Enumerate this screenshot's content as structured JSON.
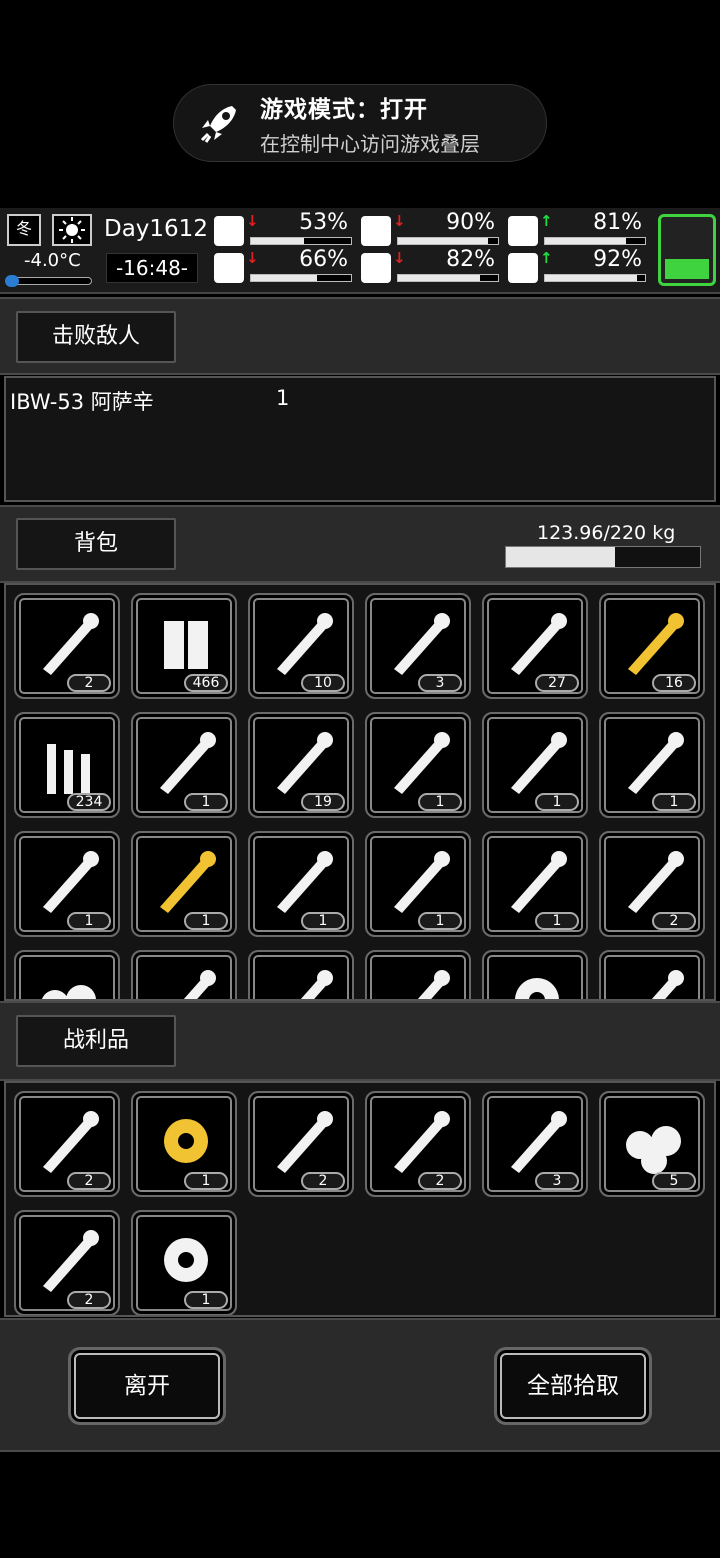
{
  "toast": {
    "title": "游戏模式：打开",
    "subtitle": "在控制中心访问游戏叠层"
  },
  "hud": {
    "season": "冬",
    "temperature": "-4.0°C",
    "day": "Day1612",
    "time": "-16:48-",
    "stats": [
      {
        "icon": "medkit-icon",
        "arrow": "down",
        "value": "53%",
        "level": 0.53
      },
      {
        "icon": "stomach-icon",
        "arrow": "down",
        "value": "90%",
        "level": 0.9
      },
      {
        "icon": "pill-icon",
        "arrow": "up",
        "value": "81%",
        "level": 0.81
      },
      {
        "icon": "boot-icon",
        "arrow": "down",
        "value": "66%",
        "level": 0.66
      },
      {
        "icon": "water-drop-icon",
        "arrow": "down",
        "value": "82%",
        "level": 0.82
      },
      {
        "icon": "heart-icon",
        "arrow": "up",
        "value": "92%",
        "level": 0.92
      }
    ],
    "battery_level": 0.3,
    "colors": {
      "down": "#e02020",
      "up": "#22dd44",
      "battery": "#3fd43f"
    }
  },
  "defeated": {
    "button": "击败敌人",
    "enemy_name": "IBW-53 阿萨辛",
    "enemy_count": "1"
  },
  "backpack": {
    "button": "背包",
    "weight": "123.96/220 kg",
    "weight_level": 0.5635,
    "items": [
      {
        "icon": "caulk-gun-icon",
        "count": "2"
      },
      {
        "icon": "battery-pack-icon",
        "count": "466"
      },
      {
        "icon": "rope-coil-icon",
        "count": "10"
      },
      {
        "icon": "lockpick-icon",
        "count": "3"
      },
      {
        "icon": "cloth-rag-icon",
        "count": "27"
      },
      {
        "icon": "gold-ore-icon",
        "count": "16"
      },
      {
        "icon": "bullets-icon",
        "count": "234"
      },
      {
        "icon": "toolbox-icon",
        "count": "1"
      },
      {
        "icon": "spray-cans-icon",
        "count": "19"
      },
      {
        "icon": "helmet-icon",
        "count": "1"
      },
      {
        "icon": "armor-plate-icon",
        "count": "1"
      },
      {
        "icon": "shovel-icon",
        "count": "1"
      },
      {
        "icon": "chain-whip-icon",
        "count": "1"
      },
      {
        "icon": "golden-mace-icon",
        "count": "1"
      },
      {
        "icon": "body-armor-icon",
        "count": "1"
      },
      {
        "icon": "mech-parts-icon",
        "count": "1"
      },
      {
        "icon": "frame-rack-icon",
        "count": "1"
      },
      {
        "icon": "minigun-icon",
        "count": "2"
      },
      {
        "icon": "stones-icon",
        "count": ""
      },
      {
        "icon": "scrap-metal-icon",
        "count": ""
      },
      {
        "icon": "metal-bar-icon",
        "count": ""
      },
      {
        "icon": "nails-icon",
        "count": ""
      },
      {
        "icon": "gear-icon",
        "count": ""
      },
      {
        "icon": "flashlight-icon",
        "count": ""
      }
    ]
  },
  "loot": {
    "button": "战利品",
    "items": [
      {
        "icon": "pipe-icon",
        "count": "2"
      },
      {
        "icon": "golden-gears-icon",
        "count": "1"
      },
      {
        "icon": "tire-icon",
        "count": "2"
      },
      {
        "icon": "engine-parts-icon",
        "count": "2"
      },
      {
        "icon": "screws-icon",
        "count": "3"
      },
      {
        "icon": "stones-icon",
        "count": "5"
      },
      {
        "icon": "scrap-metal-icon",
        "count": "2"
      },
      {
        "icon": "gears-icon",
        "count": "1"
      }
    ]
  },
  "actions": {
    "leave": "离开",
    "take_all": "全部拾取"
  }
}
